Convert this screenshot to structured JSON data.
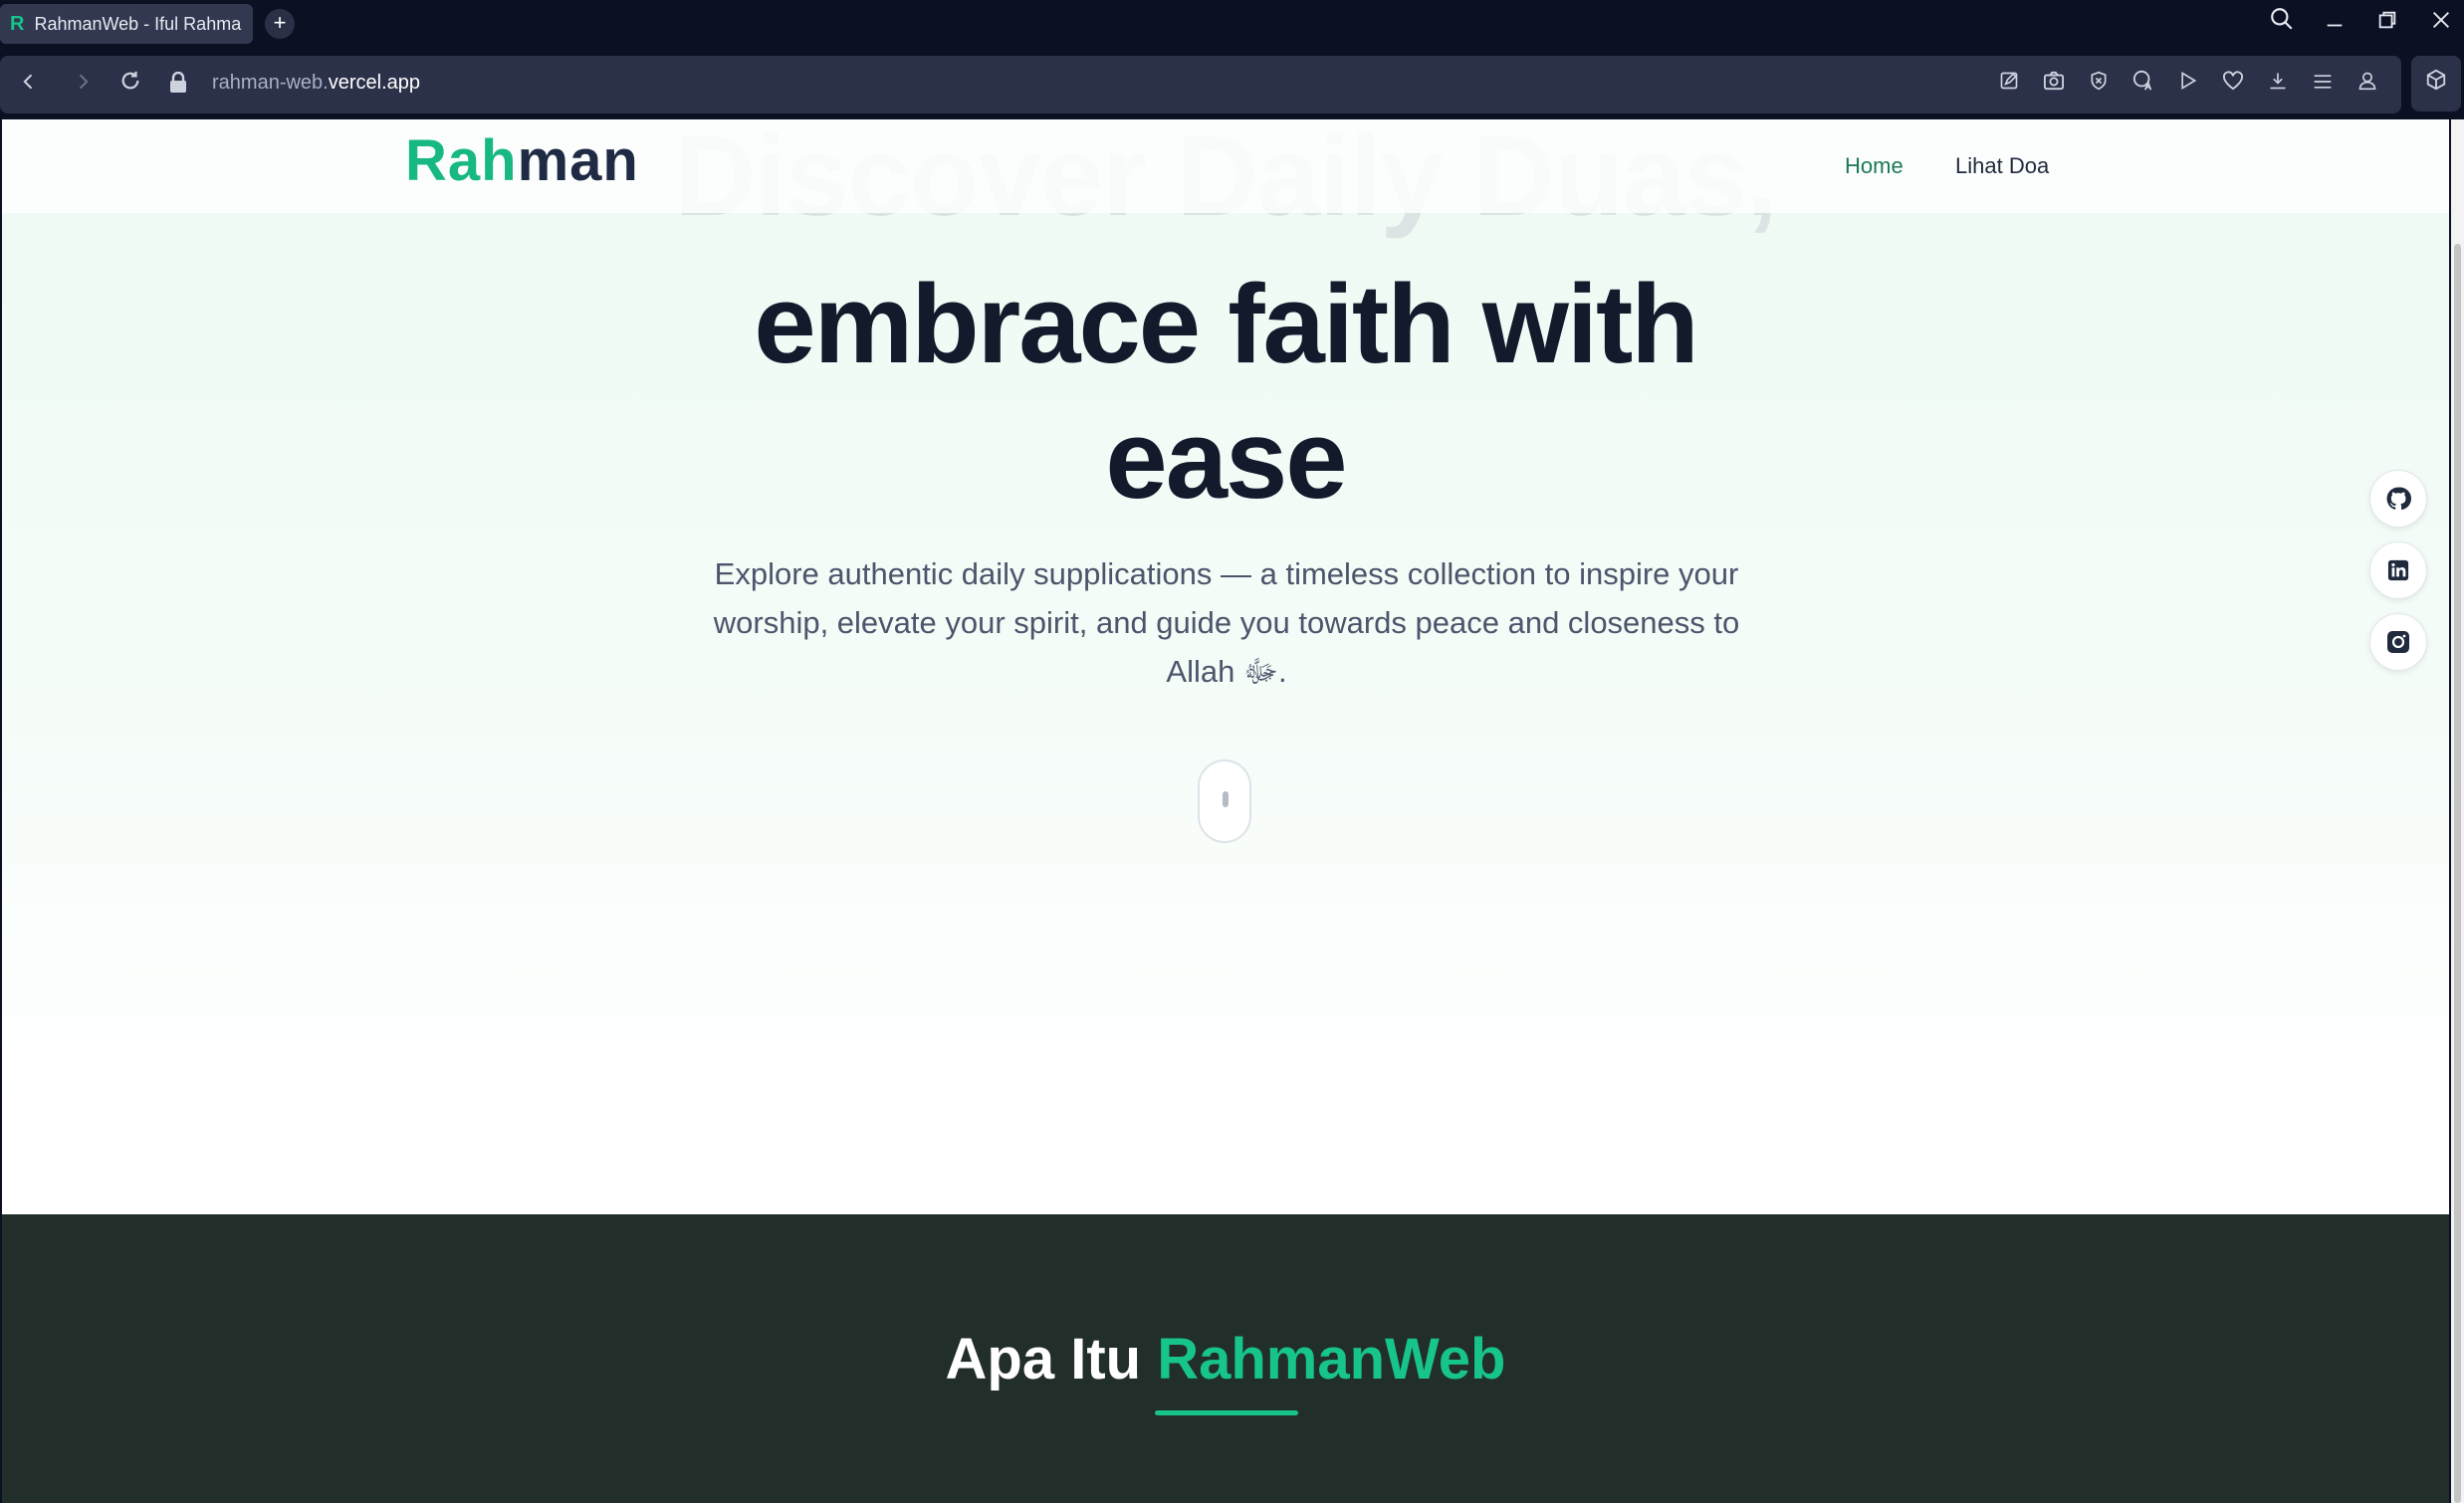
{
  "browser": {
    "tab_title": "RahmanWeb - Iful Rahma",
    "tab_favicon": "R",
    "new_tab_symbol": "+",
    "url_prefix": "rahman-web.",
    "url_domain": "vercel.app",
    "icons": [
      "back-icon",
      "forward-icon",
      "reload-icon",
      "lock-icon",
      "edit-icon",
      "camera-icon",
      "shield-icon",
      "translate-icon",
      "play-icon",
      "heart-icon",
      "download-icon",
      "menu-icon",
      "profile-icon",
      "extensions-icon",
      "search-icon",
      "minimize-icon",
      "restore-icon",
      "close-icon"
    ]
  },
  "site": {
    "logo_part1": "Rah",
    "logo_part2": "man",
    "nav": {
      "home": "Home",
      "duas": "Lihat Doa"
    },
    "ghost_heading": "Discover Daily Duas,",
    "heading_line2": "embrace faith with",
    "heading_line3": "ease",
    "subtitle": "Explore authentic daily supplications — a timeless collection to inspire your worship, elevate your spirit, and guide you towards peace and closeness to Allah ﷻ.",
    "social": [
      "github-icon",
      "linkedin-icon",
      "instagram-icon"
    ],
    "about_prefix": "Apa Itu ",
    "about_accent": "RahmanWeb"
  },
  "colors": {
    "brand": "#17c48c",
    "dark_section": "#222e2a",
    "heading": "#121a2b"
  }
}
